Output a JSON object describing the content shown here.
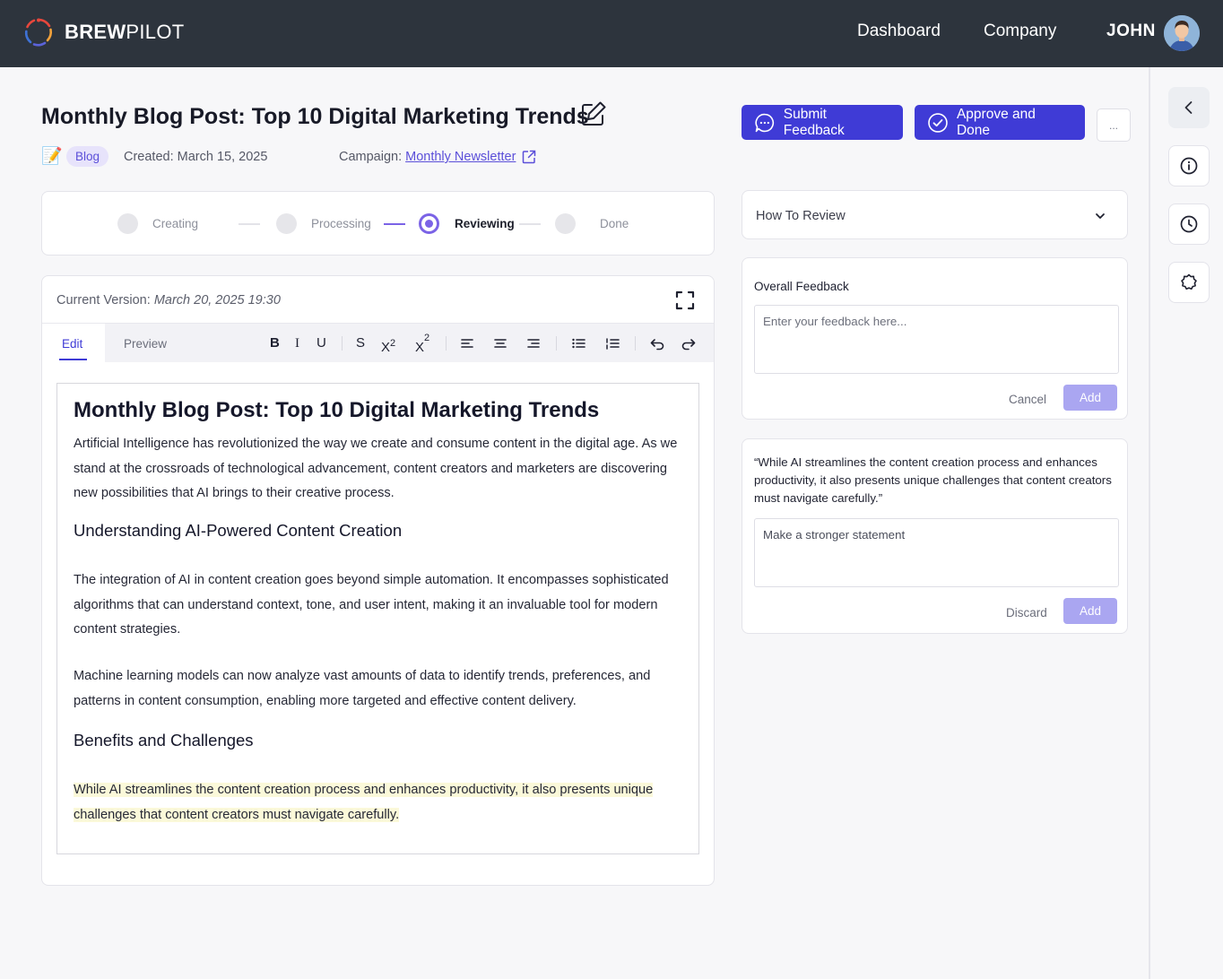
{
  "brand": {
    "name_bold": "BREW",
    "name_light": "PILOT"
  },
  "nav": {
    "dashboard": "Dashboard",
    "company": "Company",
    "user": "JOHN"
  },
  "header": {
    "title": "Monthly Blog Post: Top 10 Digital Marketing Trends",
    "emoji": "📝",
    "badge": "Blog",
    "created": "Created: March 15, 2025",
    "campaign_label": "Campaign:",
    "campaign_link": "Monthly Newsletter",
    "submit_label": "Submit Feedback",
    "approve_label": "Approve and Done",
    "more_label": "..."
  },
  "stepper": {
    "steps": [
      {
        "label": "Creating",
        "state": "pending"
      },
      {
        "label": "Processing",
        "state": "pending"
      },
      {
        "label": "Reviewing",
        "state": "active"
      },
      {
        "label": "Done",
        "state": "pending"
      }
    ]
  },
  "editor": {
    "version_label": "Current Version:",
    "version_value": "March 20, 2025 19:30",
    "tab_edit": "Edit",
    "tab_preview": "Preview",
    "toolbar": {
      "bold": "B",
      "italic": "I",
      "underline": "U",
      "strike": "S",
      "sup": "X",
      "sup_mark": "2",
      "sub": "X",
      "sub_mark": "2"
    },
    "doc": {
      "h1": "Monthly Blog Post: Top 10 Digital Marketing Trends",
      "p1": "Artificial Intelligence has revolutionized the way we create and consume content in the digital age. As we stand at the crossroads of technological advancement, content creators and marketers are discovering new possibilities that AI brings to their creative process.",
      "h2a": "Understanding AI-Powered Content Creation",
      "p2": "The integration of AI in content creation goes beyond simple automation. It encompasses sophisticated algorithms that can understand context, tone, and user intent, making it an invaluable tool for modern content strategies.",
      "p3": "Machine learning models can now analyze vast amounts of data to identify trends, preferences, and patterns in content consumption, enabling more targeted and effective content delivery.",
      "h2b": "Benefits and Challenges",
      "p4": "While AI streamlines the content creation process and enhances productivity, it also presents unique challenges that content creators must navigate carefully."
    }
  },
  "review": {
    "how_to": "How To Review",
    "overall_label": "Overall Feedback",
    "overall_placeholder": "Enter your feedback here...",
    "cancel": "Cancel",
    "add": "Add",
    "quote": "“While AI streamlines the content creation process and enhances productivity, it also presents unique challenges that content creators must navigate carefully.”",
    "comment_value": "Make a stronger statement",
    "discard": "Discard",
    "add2": "Add"
  },
  "colors": {
    "topbar": "#2d343d",
    "primary": "#3f3bd6",
    "accent": "#7b63e6",
    "highlight": "#fbf9d9",
    "disabled_add": "#aaa6f1"
  }
}
